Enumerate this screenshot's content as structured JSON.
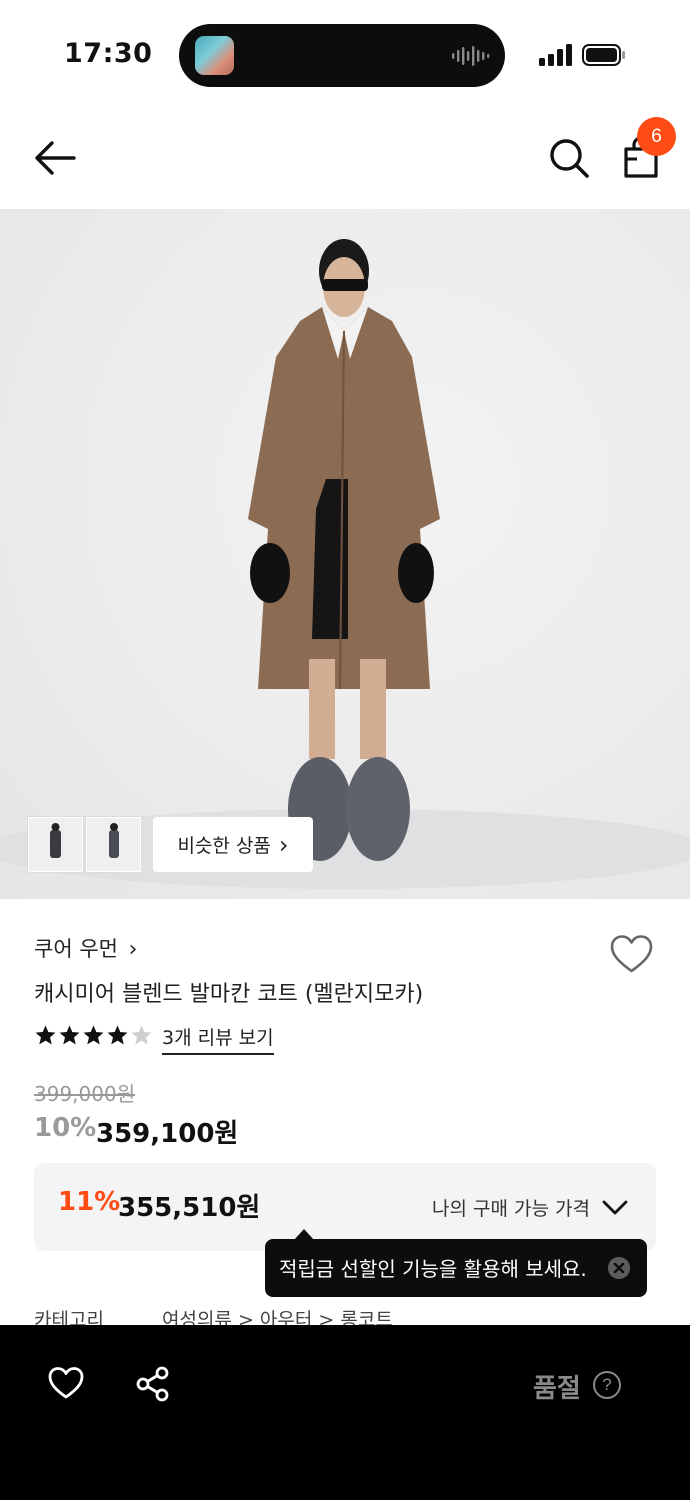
{
  "status_bar": {
    "time": "17:30"
  },
  "header": {
    "cart_count": "6"
  },
  "gallery": {
    "similar_label": "비슷한 상품",
    "similar_chevron": "›"
  },
  "product": {
    "brand": "쿠어 우먼",
    "brand_chevron": "›",
    "title": "캐시미어 블렌드 발마칸 코트 (멜란지모카)",
    "rating": 4,
    "rating_max": 5,
    "reviews_link": "3개 리뷰 보기",
    "original_price": "399,000원",
    "discount_rate": "10%",
    "sale_price": "359,100원"
  },
  "my_price": {
    "discount_rate": "11%",
    "price": "355,510원",
    "label": "나의 구매 가능 가격"
  },
  "tooltip": {
    "text": "적립금 선할인 기능을 활용해 보세요."
  },
  "category": {
    "label": "카테고리",
    "path": "여성의류 > 아우터 > 롱코트"
  },
  "bottom_bar": {
    "status": "품절",
    "help": "?"
  },
  "colors": {
    "accent": "#ff4b14",
    "bottom_bar_bg": "#000000",
    "tooltip_bg": "#0d0d0d"
  },
  "icons": [
    "back-arrow-icon",
    "search-icon",
    "shopping-bag-icon",
    "heart-icon",
    "star-icon",
    "chevron-down-icon",
    "close-icon",
    "share-icon",
    "help-icon"
  ]
}
